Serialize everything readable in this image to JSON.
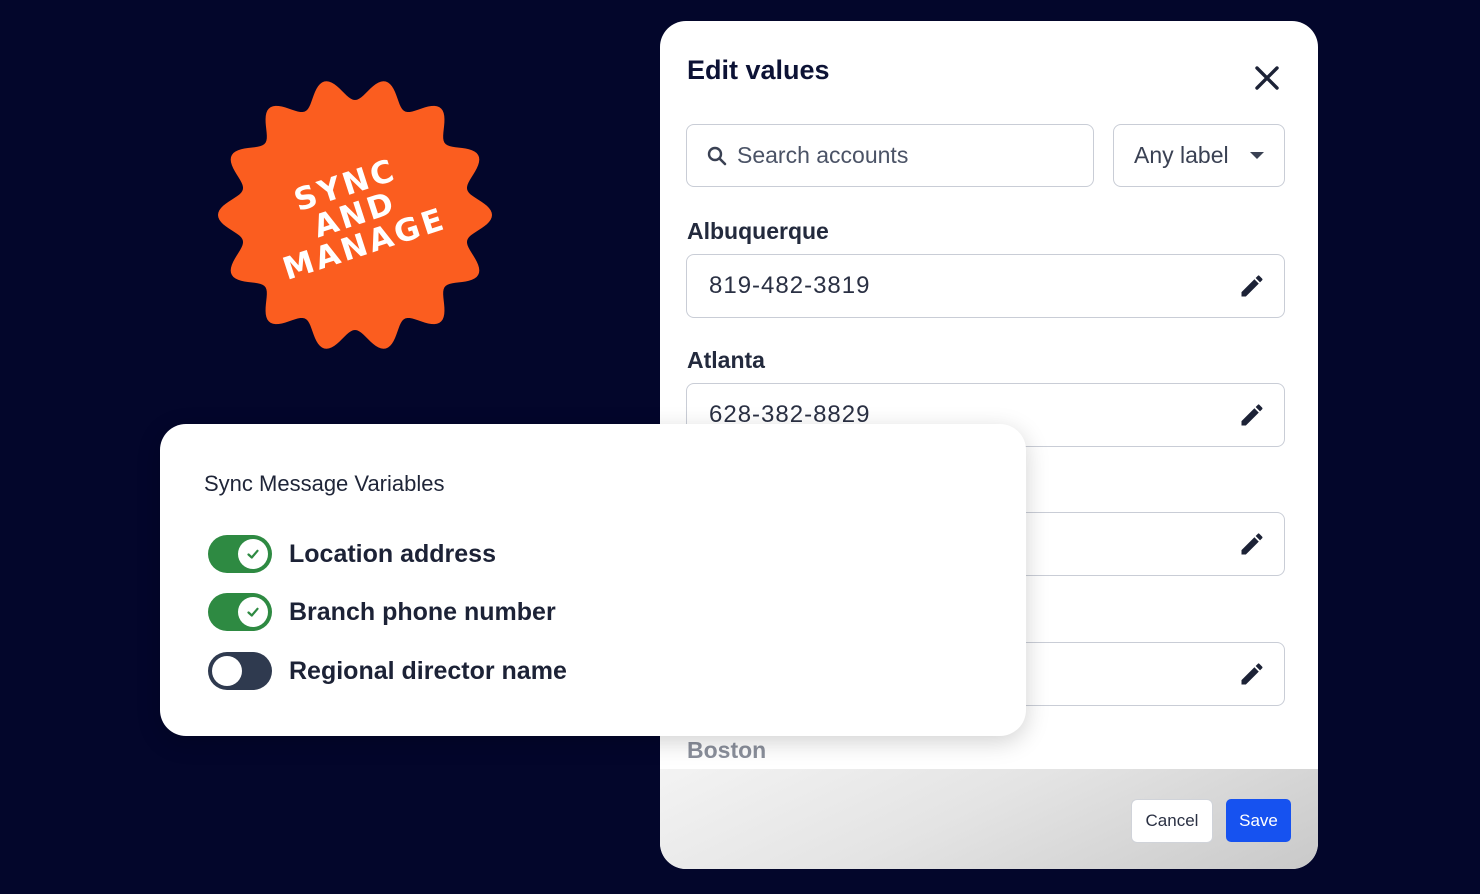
{
  "badge": {
    "lines": [
      "SYNC",
      "AND",
      "MANAGE"
    ],
    "color": "#fb5d1f"
  },
  "edit_modal": {
    "title": "Edit values",
    "search": {
      "placeholder": "Search accounts",
      "value": ""
    },
    "label_filter": {
      "selected": "Any label"
    },
    "fields": [
      {
        "label": "Albuquerque",
        "value": "819-482-3819"
      },
      {
        "label": "Atlanta",
        "value": "628-382-8829"
      },
      {
        "label": "",
        "value": ""
      },
      {
        "label": "",
        "value": ""
      },
      {
        "label": "Boston",
        "value": ""
      }
    ],
    "cancel_label": "Cancel",
    "save_label": "Save"
  },
  "sync_card": {
    "title": "Sync Message Variables",
    "toggles": [
      {
        "label": "Location address",
        "on": true
      },
      {
        "label": "Branch phone number",
        "on": true
      },
      {
        "label": "Regional director name",
        "on": false
      }
    ]
  },
  "colors": {
    "background": "#03062b",
    "badge": "#fb5d1f",
    "toggle_on": "#2e8a42",
    "toggle_off": "#2f3a4f",
    "primary_button": "#1652f0"
  },
  "icons": {
    "close": "close-icon",
    "search": "search-icon",
    "caret": "chevron-down-icon",
    "edit": "pencil-icon",
    "check": "check-icon"
  }
}
